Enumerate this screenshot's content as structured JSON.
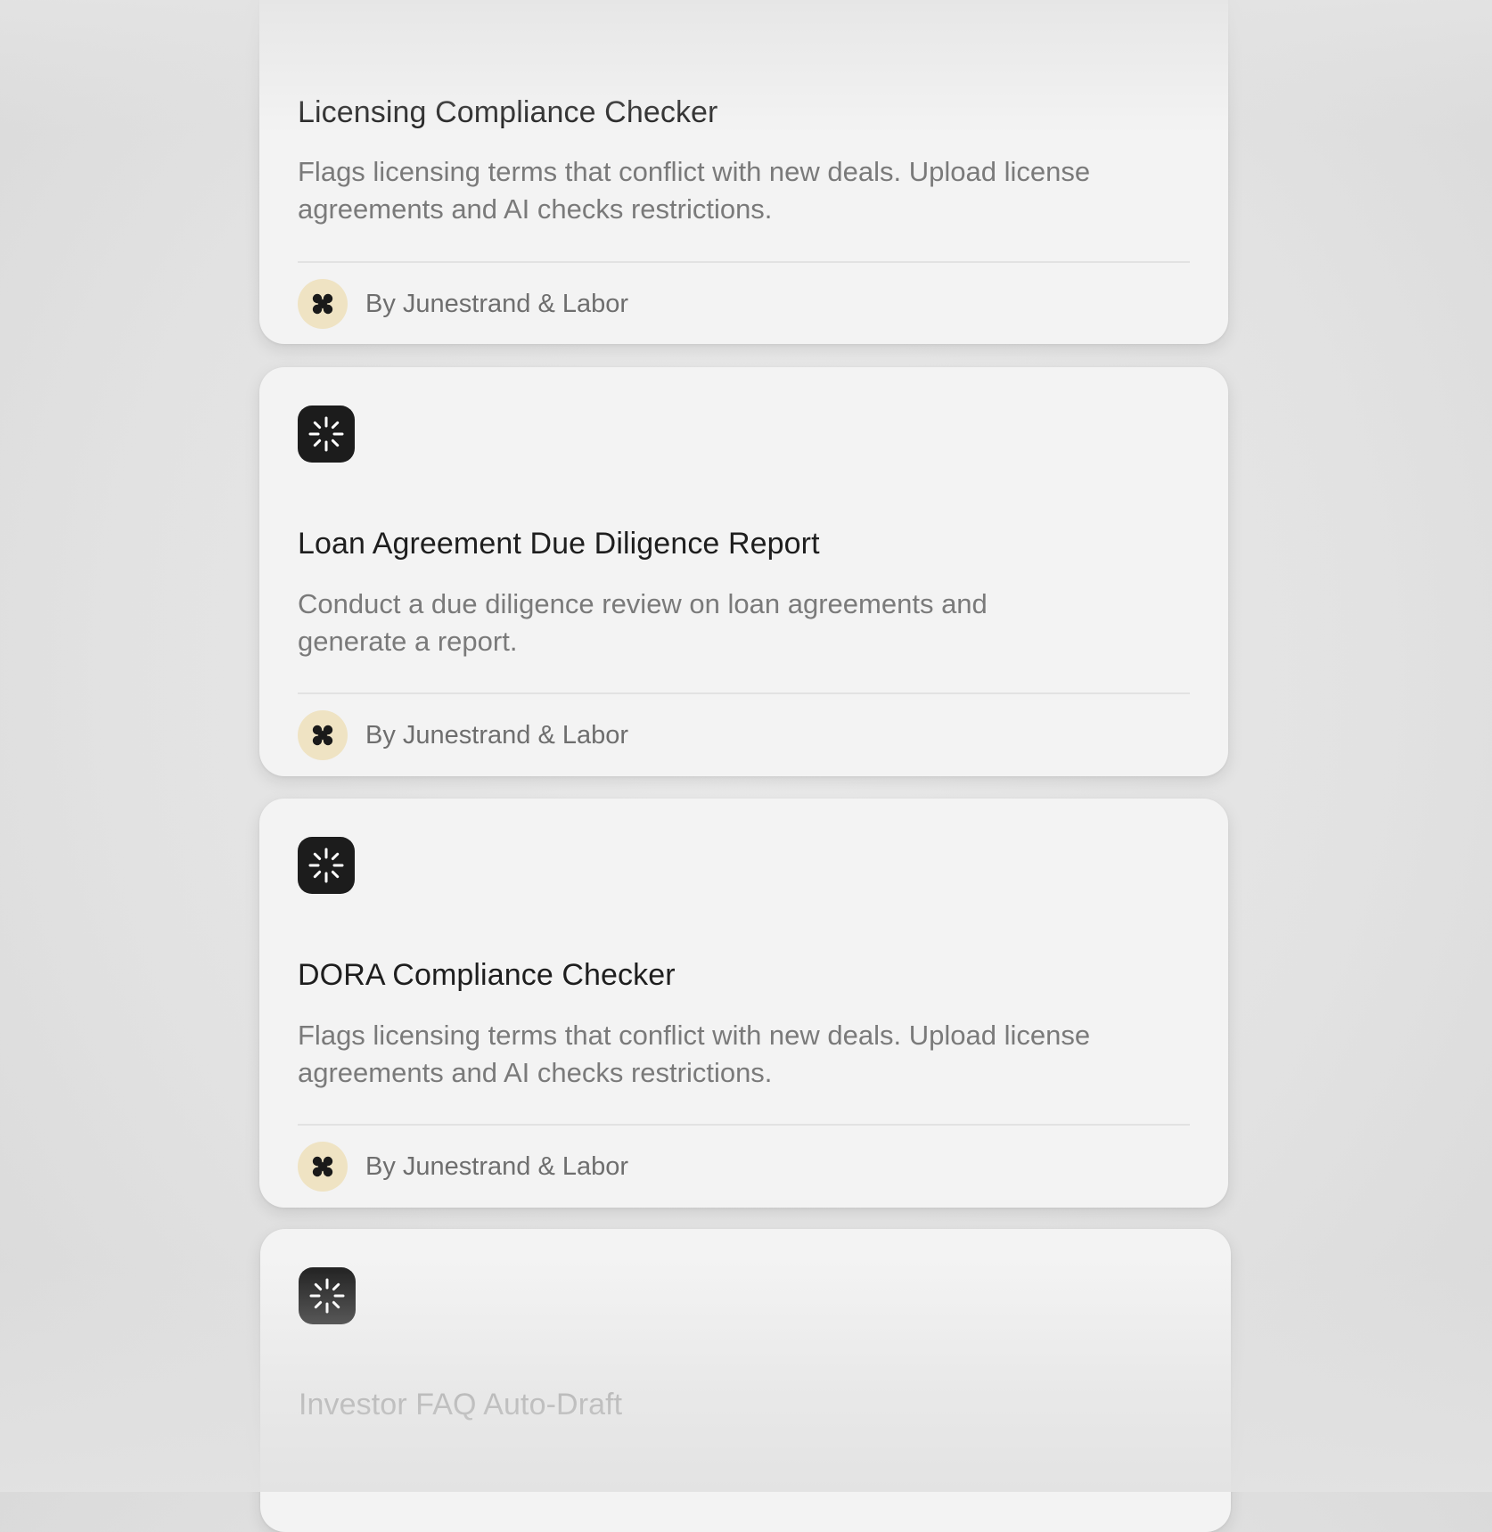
{
  "cards": [
    {
      "title": "Licensing Compliance Checker",
      "description": "Flags licensing terms that conflict with new deals. Upload license agreements and AI checks restrictions.",
      "author": "By Junestrand & Labor",
      "icon": "sparkle-icon",
      "author_icon": "four-dot-logo-icon"
    },
    {
      "title": "Loan Agreement Due Diligence Report",
      "description": "Conduct a due diligence review on loan agreements and generate a report.",
      "author": "By Junestrand & Labor",
      "icon": "sparkle-icon",
      "author_icon": "four-dot-logo-icon"
    },
    {
      "title": "DORA Compliance Checker",
      "description": "Flags licensing terms that conflict with new deals. Upload license agreements and AI checks restrictions.",
      "author": "By Junestrand & Labor",
      "icon": "sparkle-icon",
      "author_icon": "four-dot-logo-icon"
    },
    {
      "title": "Investor FAQ Auto-Draft",
      "icon": "sparkle-icon"
    }
  ],
  "colors": {
    "background": "#e4e4e4",
    "card": "#f3f3f3",
    "icon_tile": "#1c1c1c",
    "avatar": "#efe3c3"
  }
}
